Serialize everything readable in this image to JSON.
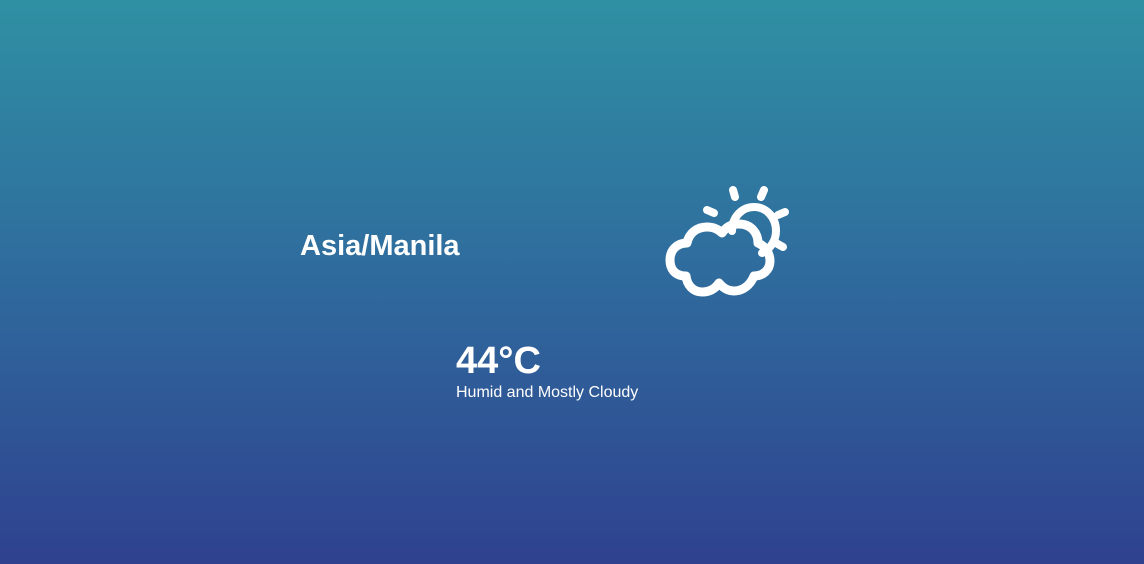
{
  "weather": {
    "location": "Asia/Manila",
    "temperature": "44°C",
    "condition": "Humid and Mostly Cloudy",
    "icon": "partly-cloudy-icon"
  },
  "colors": {
    "background_top": "#2f90a3",
    "background_bottom": "#2f418f",
    "text": "#ffffff"
  }
}
